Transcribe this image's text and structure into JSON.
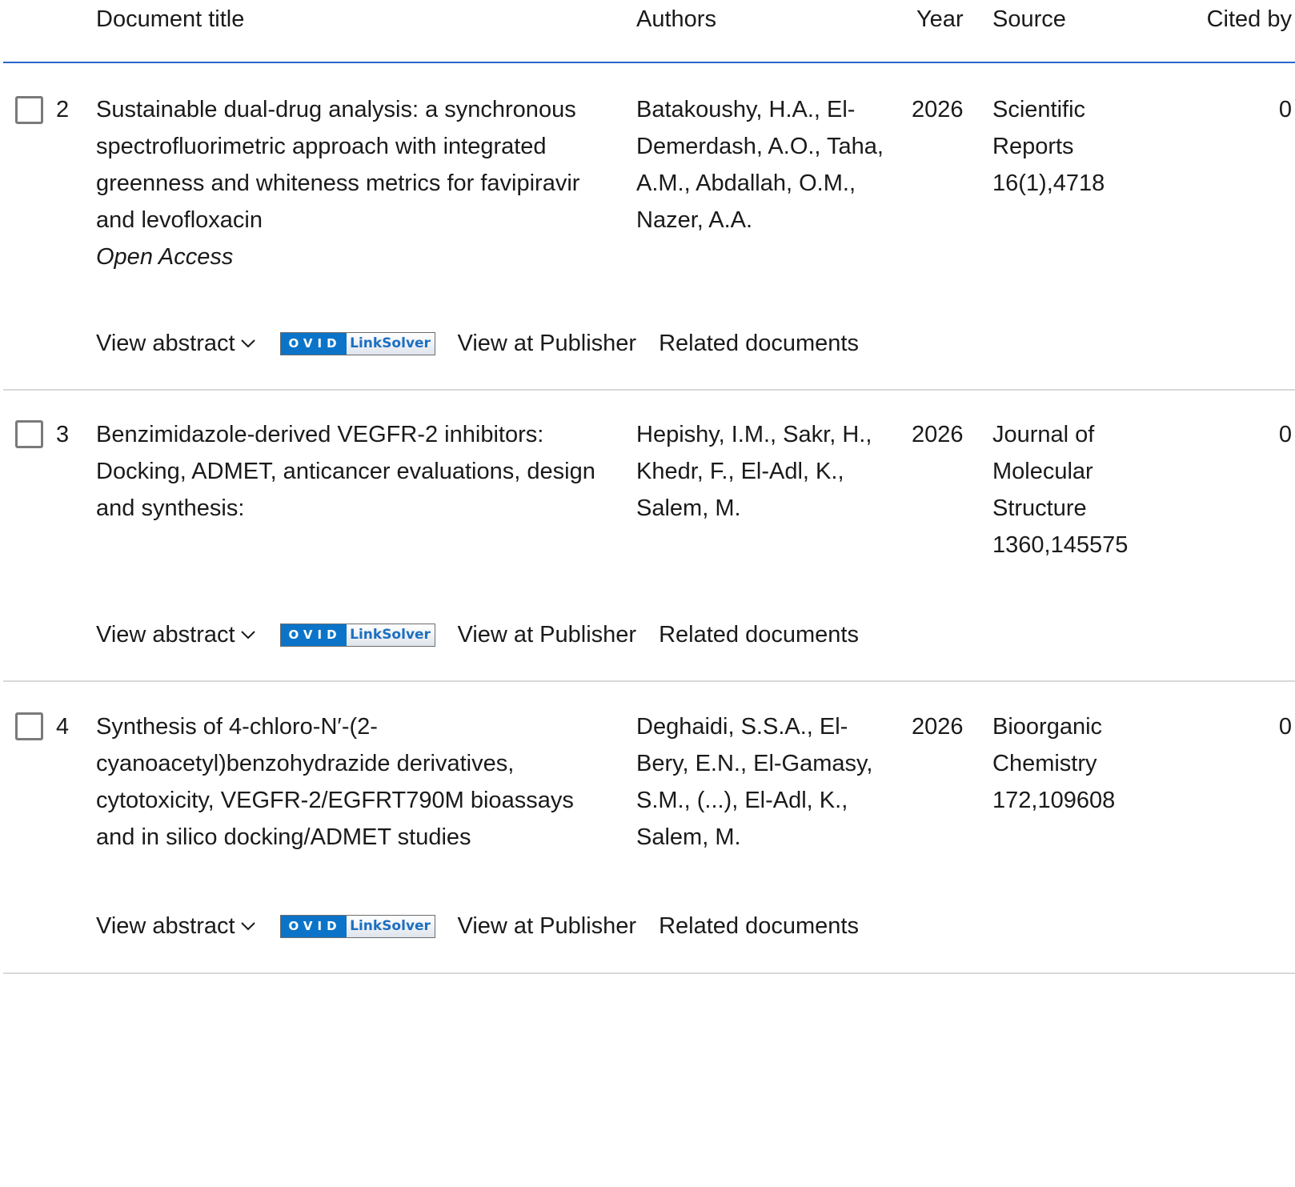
{
  "header": {
    "title": "Document title",
    "authors": "Authors",
    "year": "Year",
    "source": "Source",
    "cited_by": "Cited by"
  },
  "actions": {
    "view_abstract": "View abstract",
    "linksolver_left": "OVID",
    "linksolver_right": "LinkSolver",
    "view_at_publisher": "View at Publisher",
    "related_documents": "Related documents"
  },
  "rows": [
    {
      "number": "2",
      "title": "Sustainable dual-drug analysis: a synchronous spectrofluorimetric approach with integrated greenness and whiteness metrics for favipiravir and levofloxacin",
      "access": "Open Access",
      "authors": "Batakoushy, H.A., El-Demerdash, A.O., Taha, A.M., Abdallah, O.M., Nazer, A.A.",
      "year": "2026",
      "source": "Scientific Reports 16(1),4718",
      "cited_by": "0"
    },
    {
      "number": "3",
      "title": "Benzimidazole-derived VEGFR-2 inhibitors: Docking, ADMET, anticancer evaluations, design and synthesis:",
      "authors": "Hepishy, I.M., Sakr, H., Khedr, F., El-Adl, K., Salem, M.",
      "year": "2026",
      "source": "Journal of Molecular Structure 1360,145575",
      "cited_by": "0"
    },
    {
      "number": "4",
      "title": "Synthesis of 4-chloro-N′-(2-cyanoacetyl)benzohydrazide derivatives, cytotoxicity, VEGFR-2/EGFRT790M bioassays and in silico docking/ADMET studies",
      "authors": "Deghaidi, S.S.A., El-Bery, E.N., El-Gamasy, S.M., (...), El-Adl, K., Salem, M.",
      "year": "2026",
      "source": "Bioorganic Chemistry 172,109608",
      "cited_by": "0"
    }
  ]
}
